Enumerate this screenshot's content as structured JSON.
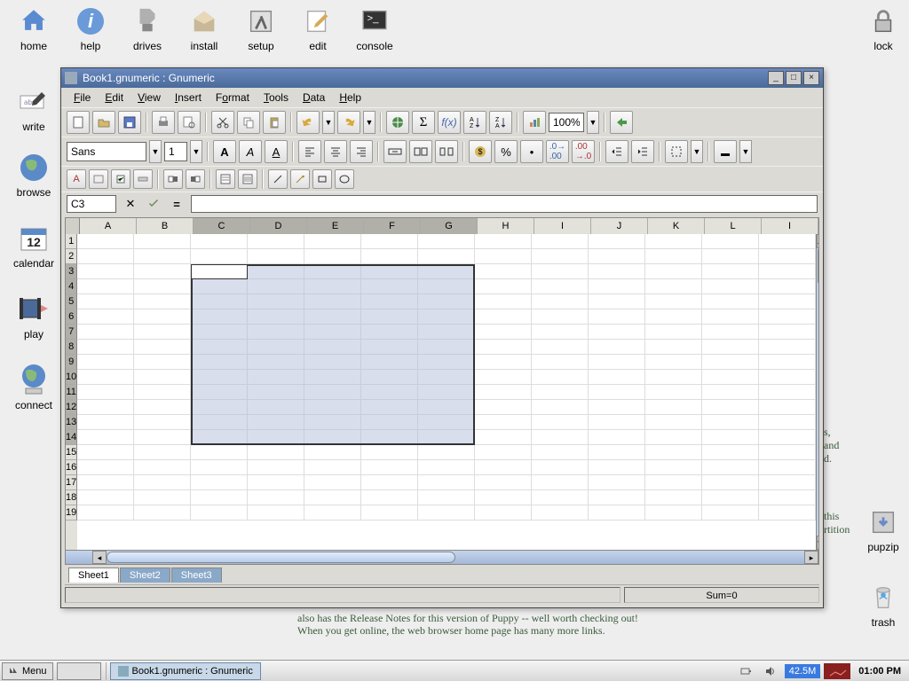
{
  "desktop_icons": {
    "home": "home",
    "help": "help",
    "drives": "drives",
    "install": "install",
    "setup": "setup",
    "edit": "edit",
    "console": "console",
    "lock": "lock",
    "write": "write",
    "browse": "browse",
    "calendar": "calendar",
    "play": "play",
    "connect": "connect",
    "pupzip": "pupzip",
    "trash": "trash"
  },
  "calendar_day": "12",
  "bg_text1": "also has the Release Notes for this version of Puppy -- well worth checking out!",
  "bg_text2": "When you get online, the web browser home page has many more links.",
  "window": {
    "title": "Book1.gnumeric : Gnumeric",
    "menus": [
      "File",
      "Edit",
      "View",
      "Insert",
      "Format",
      "Tools",
      "Data",
      "Help"
    ],
    "font_name": "Sans",
    "font_size": "1",
    "zoom": "100%",
    "cell_ref": "C3",
    "formula": "",
    "columns": [
      "A",
      "B",
      "C",
      "D",
      "E",
      "F",
      "G",
      "H",
      "I",
      "J",
      "K",
      "L",
      "I"
    ],
    "rows": [
      "1",
      "2",
      "3",
      "4",
      "5",
      "6",
      "7",
      "8",
      "9",
      "10",
      "11",
      "12",
      "13",
      "14",
      "15",
      "16",
      "17",
      "18",
      "19"
    ],
    "sel_cols": [
      "C",
      "D",
      "E",
      "F",
      "G"
    ],
    "sel_rows": [
      "3",
      "4",
      "5",
      "6",
      "7",
      "8",
      "9",
      "10",
      "11",
      "12",
      "13",
      "14"
    ],
    "sheets": [
      "Sheet1",
      "Sheet2",
      "Sheet3"
    ],
    "active_sheet": "Sheet1",
    "status_sum": "Sum=0"
  },
  "taskbar": {
    "menu": "Menu",
    "task": "Book1.gnumeric : Gnumeric",
    "mem": "42.5M",
    "time": "01:00 PM"
  }
}
